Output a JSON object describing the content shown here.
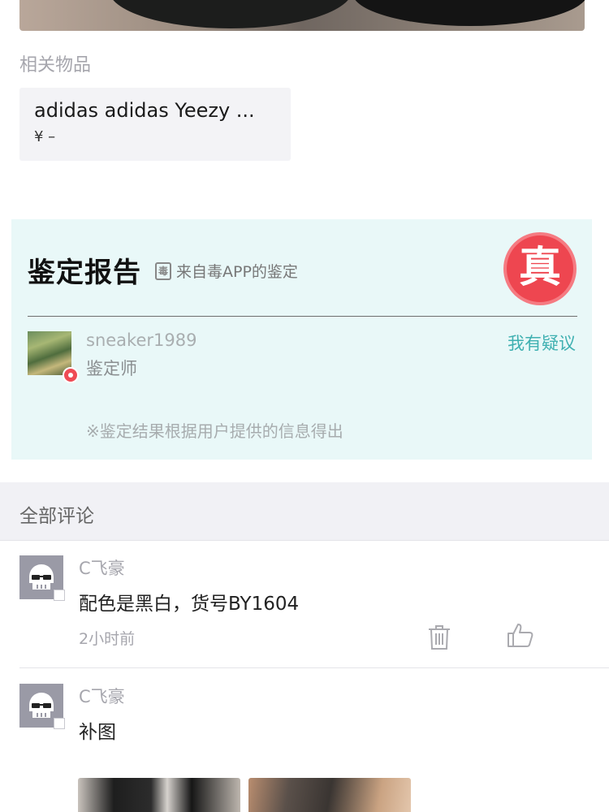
{
  "related": {
    "title": "相关物品",
    "item_name": "adidas adidas Yeezy ...",
    "item_price": "¥ –"
  },
  "report": {
    "title": "鉴定报告",
    "source": "来自毒APP的鉴定",
    "source_icon_glyph": "毒",
    "seal_text": "真",
    "appraiser_name": "sneaker1989",
    "appraiser_role": "鉴定师",
    "dispute_label": "我有疑议",
    "note": "※鉴定结果根据用户提供的信息得出",
    "colors": {
      "background": "#e9f8f8",
      "seal": "#ee4650",
      "accent": "#3fb0b1"
    }
  },
  "comments": {
    "header": "全部评论",
    "items": [
      {
        "author": "C飞豪",
        "text": "配色是黑白，货号BY1604",
        "time": "2小时前"
      },
      {
        "author": "C飞豪",
        "text": "补图"
      }
    ]
  },
  "icons": [
    "skull-avatar-icon",
    "trash-icon",
    "thumbs-up-icon",
    "document-icon",
    "verified-badge-icon"
  ]
}
